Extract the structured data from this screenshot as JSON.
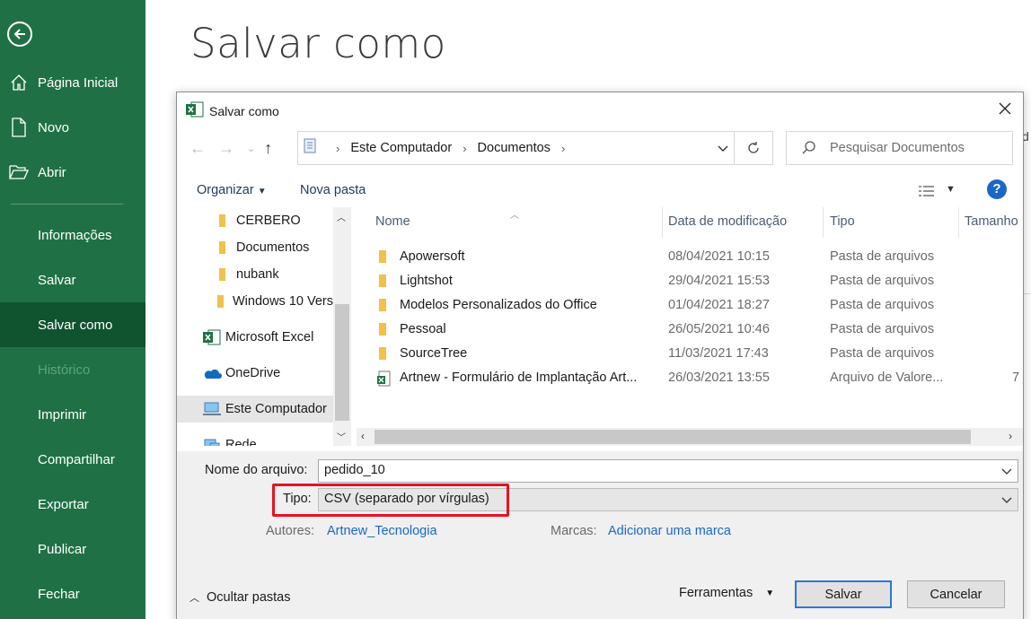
{
  "backstage": {
    "page_title": "Salvar como",
    "nav": [
      {
        "label": "Página Inicial",
        "icon": "home-icon"
      },
      {
        "label": "Novo",
        "icon": "new-document-icon"
      },
      {
        "label": "Abrir",
        "icon": "open-folder-icon"
      },
      {
        "label": "Informações"
      },
      {
        "label": "Salvar"
      },
      {
        "label": "Salvar como"
      },
      {
        "label": "Histórico"
      },
      {
        "label": "Imprimir"
      },
      {
        "label": "Compartilhar"
      },
      {
        "label": "Exportar"
      },
      {
        "label": "Publicar"
      },
      {
        "label": "Fechar"
      }
    ],
    "partial_text": "d"
  },
  "dialog": {
    "title": "Salvar como",
    "close_icon": "close-icon",
    "address": {
      "segments": [
        "Este Computador",
        "Documentos"
      ]
    },
    "search": {
      "placeholder": "Pesquisar Documentos"
    },
    "toolbar": {
      "organize": "Organizar",
      "new_folder": "Nova pasta",
      "help": "?"
    },
    "tree": [
      {
        "label": "CERBERO",
        "icon": "folder-icon"
      },
      {
        "label": "Documentos",
        "icon": "folder-icon"
      },
      {
        "label": "nubank",
        "icon": "folder-icon"
      },
      {
        "label": "Windows 10 Vers",
        "icon": "folder-icon"
      },
      {
        "label": "Microsoft Excel",
        "icon": "excel-icon"
      },
      {
        "label": "OneDrive",
        "icon": "onedrive-icon"
      },
      {
        "label": "Este Computador",
        "icon": "computer-icon"
      },
      {
        "label": "Rede",
        "icon": "network-icon"
      }
    ],
    "columns": {
      "name": "Nome",
      "date": "Data de modificação",
      "type": "Tipo",
      "size": "Tamanho"
    },
    "files": [
      {
        "name": "Apowersoft",
        "date": "08/04/2021 10:15",
        "type": "Pasta de arquivos",
        "size": "",
        "icon": "folder-icon"
      },
      {
        "name": "Lightshot",
        "date": "29/04/2021 15:53",
        "type": "Pasta de arquivos",
        "size": "",
        "icon": "folder-icon"
      },
      {
        "name": "Modelos Personalizados do Office",
        "date": "01/04/2021 18:27",
        "type": "Pasta de arquivos",
        "size": "",
        "icon": "folder-icon"
      },
      {
        "name": "Pessoal",
        "date": "26/05/2021 10:46",
        "type": "Pasta de arquivos",
        "size": "",
        "icon": "folder-icon"
      },
      {
        "name": "SourceTree",
        "date": "11/03/2021 17:43",
        "type": "Pasta de arquivos",
        "size": "",
        "icon": "folder-icon"
      },
      {
        "name": "Artnew - Formulário de Implantação Art...",
        "date": "26/03/2021 13:55",
        "type": "Arquivo de Valore...",
        "size": "7",
        "icon": "csv-file-icon"
      }
    ],
    "form": {
      "filename_label": "Nome do arquivo:",
      "filename_value": "pedido_10",
      "type_label": "Tipo:",
      "type_value": "CSV (separado por vírgulas)",
      "authors_label": "Autores:",
      "authors_value": "Artnew_Tecnologia",
      "tags_label": "Marcas:",
      "tags_value": "Adicionar uma marca",
      "highlight_color": "#e81123"
    },
    "footer": {
      "hide_folders": "Ocultar pastas",
      "tools": "Ferramentas",
      "save": "Salvar",
      "cancel": "Cancelar"
    }
  },
  "colors": {
    "excel_green": "#1f7145",
    "excel_green_selected": "#10532f",
    "link_blue": "#1a67c7"
  }
}
